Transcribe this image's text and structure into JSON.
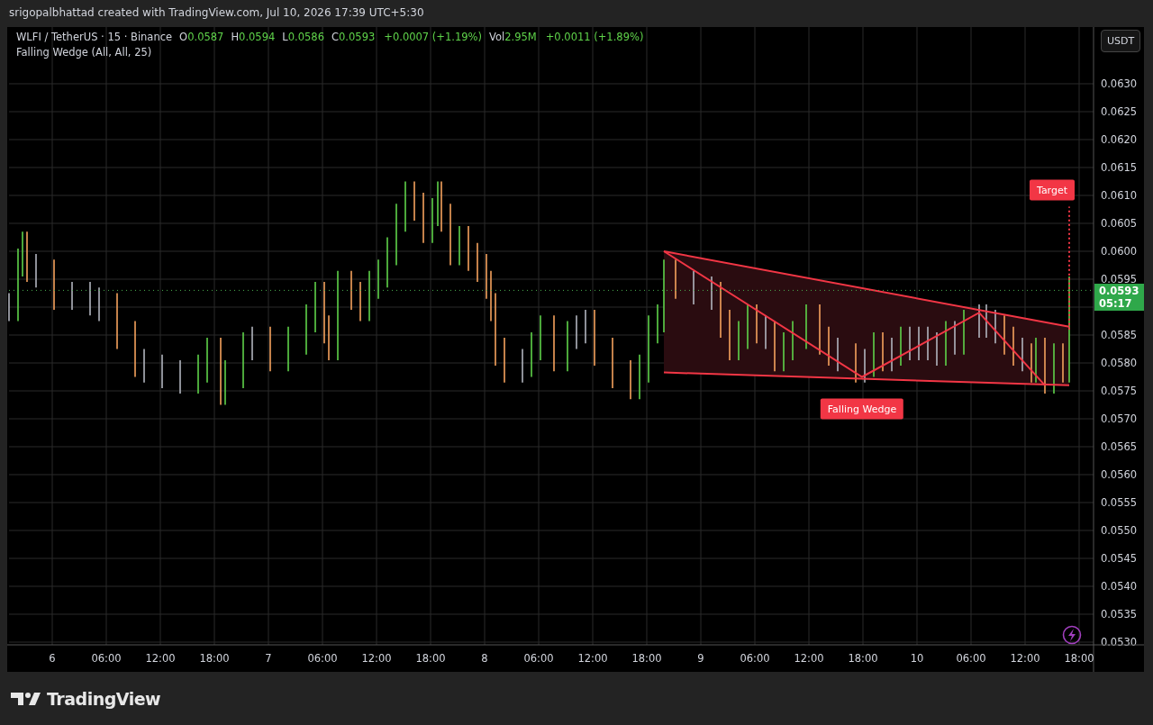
{
  "credit": "srigopalbhattad created with TradingView.com, Jul 10, 2026 17:39 UTC+5:30",
  "legend": {
    "symbol": "WLFI / TetherUS · 15 · Binance",
    "fields": [
      {
        "label": "O",
        "value": "0.0587"
      },
      {
        "label": "H",
        "value": "0.0594"
      },
      {
        "label": "L",
        "value": "0.0586"
      },
      {
        "label": "C",
        "value": "0.0593"
      }
    ],
    "change": "+0.0007 (+1.19%)",
    "volume": {
      "label": "Vol",
      "value": "2.95M",
      "change": "+0.0011 (+1.89%)"
    },
    "indicator": "Falling Wedge (All, All, 25)"
  },
  "currency_button": "USDT",
  "price_axis": [
    "0.0630",
    "0.0625",
    "0.0620",
    "0.0615",
    "0.0610",
    "0.0605",
    "0.0600",
    "0.0595",
    "0.0585",
    "0.0580",
    "0.0575",
    "0.0570",
    "0.0565",
    "0.0560",
    "0.0555",
    "0.0550",
    "0.0545",
    "0.0540",
    "0.0535",
    "0.0530"
  ],
  "time_axis": [
    "6",
    "06:00",
    "12:00",
    "18:00",
    "7",
    "06:00",
    "12:00",
    "18:00",
    "8",
    "06:00",
    "12:00",
    "18:00",
    "9",
    "06:00",
    "12:00",
    "18:00",
    "10",
    "06:00",
    "12:00",
    "18:00"
  ],
  "pattern_label": "Falling Wedge",
  "target_label": "Target",
  "last_price": {
    "value": "0.0593",
    "countdown": "05:17"
  },
  "brand": "TradingView"
}
